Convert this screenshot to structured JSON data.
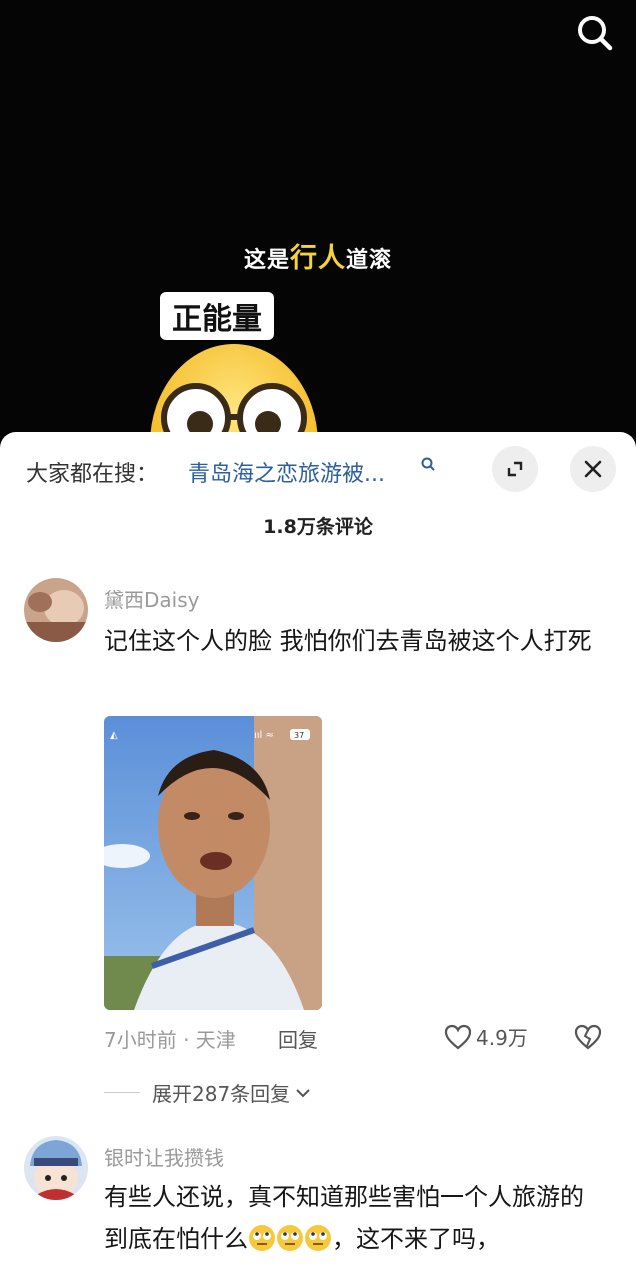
{
  "video": {
    "caption_pre": "这是",
    "caption_highlight": "行人",
    "caption_post": "道滚",
    "tag": "正能量"
  },
  "sheet": {
    "hot_search_label": "大家都在搜：",
    "hot_search_query": "青岛海之恋旅游被...",
    "comment_count": "1.8万条评论"
  },
  "comments": [
    {
      "user": "黛西Daisy",
      "text": "记住这个人的脸  我怕你们去青岛被这个人打死",
      "time_location": "7小时前 · 天津",
      "reply_label": "回复",
      "likes": "4.9万",
      "expand_label": "展开287条回复",
      "photo_battery": "37"
    },
    {
      "user": "银时让我攒钱",
      "text_part1": "有些人还说，真不知道那些害怕一个人旅游的到底在怕什么",
      "text_part2": "，这不来了吗，"
    }
  ],
  "colors": {
    "accent_link": "#2b5f9f",
    "caption_highlight": "#f6d23b"
  }
}
